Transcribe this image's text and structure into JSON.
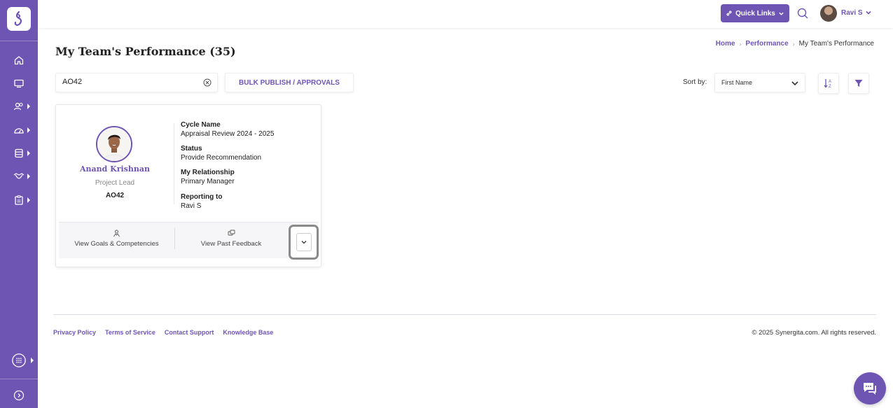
{
  "sidebar": {
    "items": [
      {
        "icon": "home-icon",
        "has_submenu": false
      },
      {
        "icon": "monitor-icon",
        "has_submenu": false
      },
      {
        "icon": "team-icon",
        "has_submenu": true
      },
      {
        "icon": "dashboard-icon",
        "has_submenu": true
      },
      {
        "icon": "database-icon",
        "has_submenu": true
      },
      {
        "icon": "handshake-icon",
        "has_submenu": true
      },
      {
        "icon": "clipboard-icon",
        "has_submenu": true
      }
    ],
    "bottom": [
      {
        "icon": "apps-grid-icon",
        "has_submenu": true
      },
      {
        "icon": "expand-sidebar-icon",
        "has_submenu": false
      }
    ]
  },
  "topbar": {
    "quick_links": "Quick Links",
    "user_name": "Ravi S"
  },
  "header": {
    "title": "My Team's Performance (35)",
    "breadcrumb": [
      "Home",
      "Performance",
      "My Team's Performance"
    ]
  },
  "toolbar": {
    "search_value": "AO42",
    "bulk_label": "BULK PUBLISH / APPROVALS",
    "sort_label": "Sort by:",
    "sort_value": "First Name"
  },
  "card": {
    "name": "Anand Krishnan",
    "role": "Project Lead",
    "id": "AO42",
    "fields": [
      {
        "label": "Cycle Name",
        "value": "Appraisal Review 2024 - 2025"
      },
      {
        "label": "Status",
        "value": "Provide Recommendation"
      },
      {
        "label": "My Relationship",
        "value": "Primary Manager"
      },
      {
        "label": "Reporting to",
        "value": "Ravi S"
      }
    ],
    "actions": {
      "goals": "View Goals & Competencies",
      "feedback": "View Past Feedback"
    }
  },
  "footer": {
    "links": [
      "Privacy Policy",
      "Terms of Service",
      "Contact Support",
      "Knowledge Base"
    ],
    "copyright": "© 2025 Synergita.com. All rights reserved."
  },
  "colors": {
    "accent": "#6f55b3",
    "sidebar": "#6f55b3"
  }
}
